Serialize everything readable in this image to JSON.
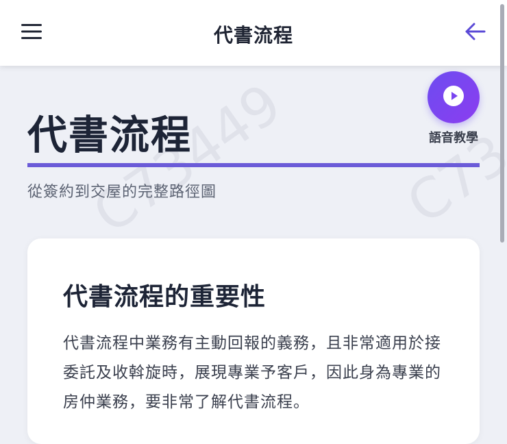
{
  "app_bar": {
    "title": "代書流程",
    "menu_icon": "hamburger-menu-icon",
    "back_icon": "arrow-left-icon"
  },
  "page": {
    "title": "代書流程",
    "subtitle": "從簽約到交屋的完整路徑圖",
    "accent_color": "#6b5bd8"
  },
  "audio": {
    "label": "語音教學",
    "icon": "play-icon",
    "color": "#7a45f0"
  },
  "watermark": {
    "text_1": "C73449",
    "text_2": "C73"
  },
  "card": {
    "title": "代書流程的重要性",
    "body": "代書流程中業務有主動回報的義務，且非常適用於接委託及收斡旋時，展現專業予客戶，因此身為專業的房仲業務，要非常了解代書流程。"
  }
}
